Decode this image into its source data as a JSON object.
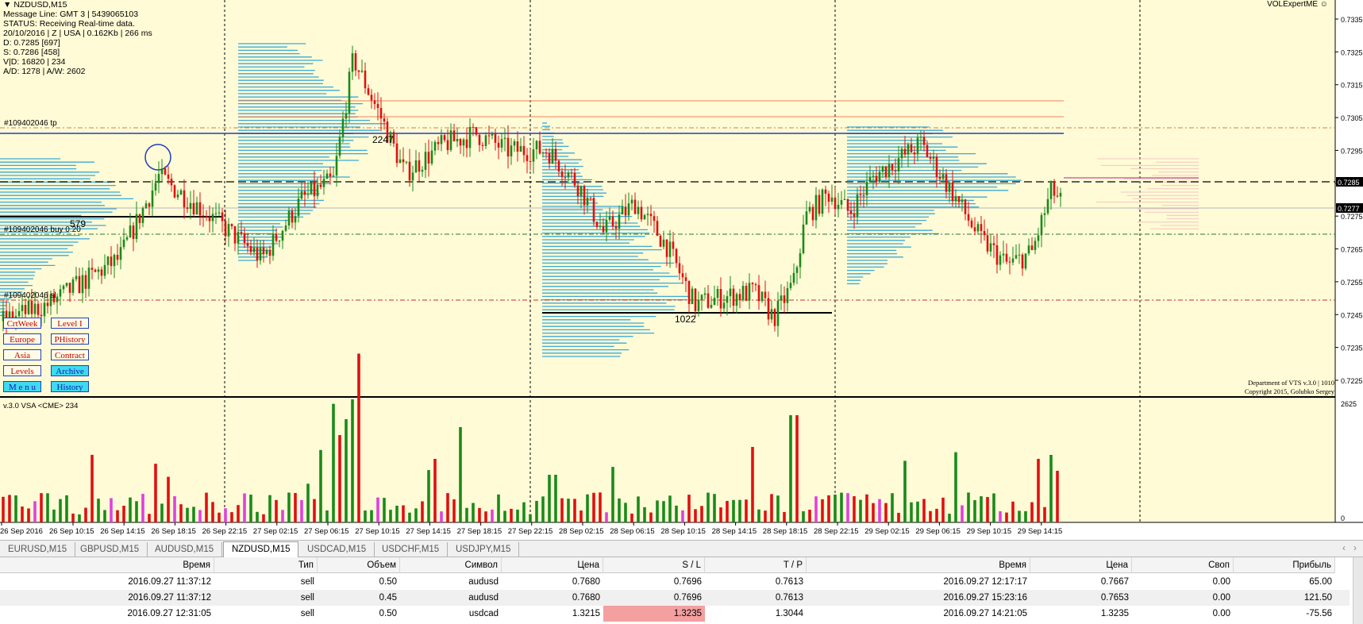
{
  "chart": {
    "symbol": "NZDUSD,M15",
    "expert_label": "VOLExpertME",
    "info_lines": [
      "Message Line: GMT 3 | 5439065103",
      "STATUS:  Receiving Real-time data.",
      "20/10/2016 | Z | USA | 0.162Kb | 266 ms",
      "D: 0.7285  [697]",
      "S: 0.7286  [458]",
      "V|D: 16820 | 234",
      "A/D: 1278 | A/W: 2602"
    ],
    "order_labels": {
      "tp": "#109402046 tp",
      "buy": "#109402046 buy 0.20",
      "sl": "#109402046 sl"
    },
    "volume_labels": [
      "579",
      "2247",
      "1022"
    ],
    "price_axis": [
      "0.7335",
      "0.7325",
      "0.7315",
      "0.7305",
      "0.7295",
      "0.7285",
      "0.7275",
      "0.7265",
      "0.7255",
      "0.7245",
      "0.7235",
      "0.7225"
    ],
    "price_badges": [
      "0.7285",
      "0.7277"
    ],
    "volume_axis": [
      "2625",
      "0"
    ],
    "indicator_title": "v.3.0 VSA <CME> 234",
    "copyright": [
      "Department of VTS  v.3.0 | 1010",
      "Copyright 2015, Golubko Sergey"
    ],
    "time_axis": [
      "26 Sep 2016",
      "26 Sep 10:15",
      "26 Sep 14:15",
      "26 Sep 18:15",
      "26 Sep 22:15",
      "27 Sep 02:15",
      "27 Sep 06:15",
      "27 Sep 10:15",
      "27 Sep 14:15",
      "27 Sep 18:15",
      "27 Sep 22:15",
      "28 Sep 02:15",
      "28 Sep 06:15",
      "28 Sep 10:15",
      "28 Sep 14:15",
      "28 Sep 18:15",
      "28 Sep 22:15",
      "29 Sep 02:15",
      "29 Sep 06:15",
      "29 Sep 10:15",
      "29 Sep 14:15"
    ],
    "buttons": [
      [
        "CrtWeek",
        "Level I"
      ],
      [
        "Europe",
        "PHistory"
      ],
      [
        "Asia",
        "Contract"
      ],
      [
        "Levels",
        "Archive"
      ],
      [
        "M e n u",
        "History"
      ]
    ],
    "colors": {
      "background": "#fffbd6",
      "bull": "#1a8a1a",
      "bear": "#e01010",
      "profile": "#3aaad8",
      "tp_line": "#1f3fbf"
    }
  },
  "tabs": [
    "EURUSD,M15",
    "GBPUSD,M15",
    "AUDUSD,M15",
    "NZDUSD,M15",
    "USDCAD,M15",
    "USDCHF,M15",
    "USDJPY,M15"
  ],
  "active_tab": "NZDUSD,M15",
  "table": {
    "headers": [
      "Время",
      "Тип",
      "Объем",
      "Символ",
      "Цена",
      "S / L",
      "T / P",
      "Время",
      "Цена",
      "Своп",
      "Прибыль"
    ],
    "rows": [
      [
        "2016.09.27 11:37:12",
        "sell",
        "0.50",
        "audusd",
        "0.7680",
        "0.7696",
        "0.7613",
        "2016.09.27 12:17:17",
        "0.7667",
        "0.00",
        "65.00"
      ],
      [
        "2016.09.27 11:37:12",
        "sell",
        "0.45",
        "audusd",
        "0.7680",
        "0.7696",
        "0.7613",
        "2016.09.27 15:23:16",
        "0.7653",
        "0.00",
        "121.50"
      ],
      [
        "2016.09.27 12:31:05",
        "sell",
        "0.50",
        "usdcad",
        "1.3215",
        "1.3235",
        "1.3044",
        "2016.09.27 14:21:05",
        "1.3235",
        "0.00",
        "-75.56"
      ]
    ]
  }
}
